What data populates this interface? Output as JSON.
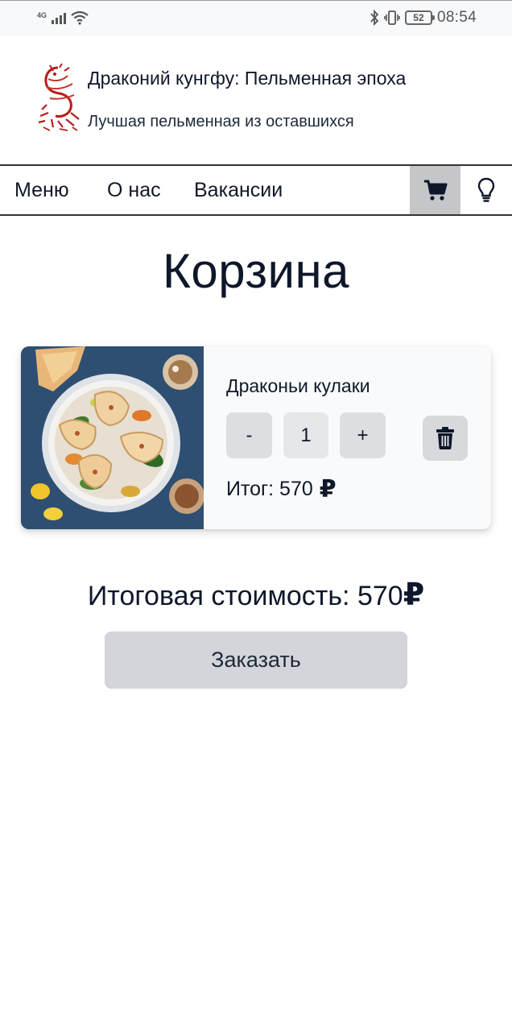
{
  "status_bar": {
    "network": "4G",
    "battery": "52",
    "time": "08:54"
  },
  "brand": {
    "title": "Драконий кунгфу: Пельменная эпоха",
    "subtitle": "Лучшая пельменная из оставшихся"
  },
  "nav": {
    "items": [
      {
        "label": "Меню"
      },
      {
        "label": "О нас"
      },
      {
        "label": "Вакансии"
      }
    ],
    "cart_icon": "cart-icon",
    "idea_icon": "lightbulb-icon"
  },
  "page": {
    "title": "Корзина"
  },
  "cart": {
    "items": [
      {
        "name": "Драконьи кулаки",
        "minus_label": "-",
        "quantity": "1",
        "plus_label": "+",
        "total_label": "Итог: 570",
        "currency": "₽"
      }
    ]
  },
  "summary": {
    "total_label": "Итоговая стоимость: 570",
    "currency": "₽",
    "order_button": "Заказать"
  },
  "colors": {
    "text": "#0f172a",
    "nav_active_bg": "#c4c6c9",
    "button_bg": "#d4d5da",
    "card_bg": "#f8fafc",
    "logo_red": "#b91c1c"
  }
}
